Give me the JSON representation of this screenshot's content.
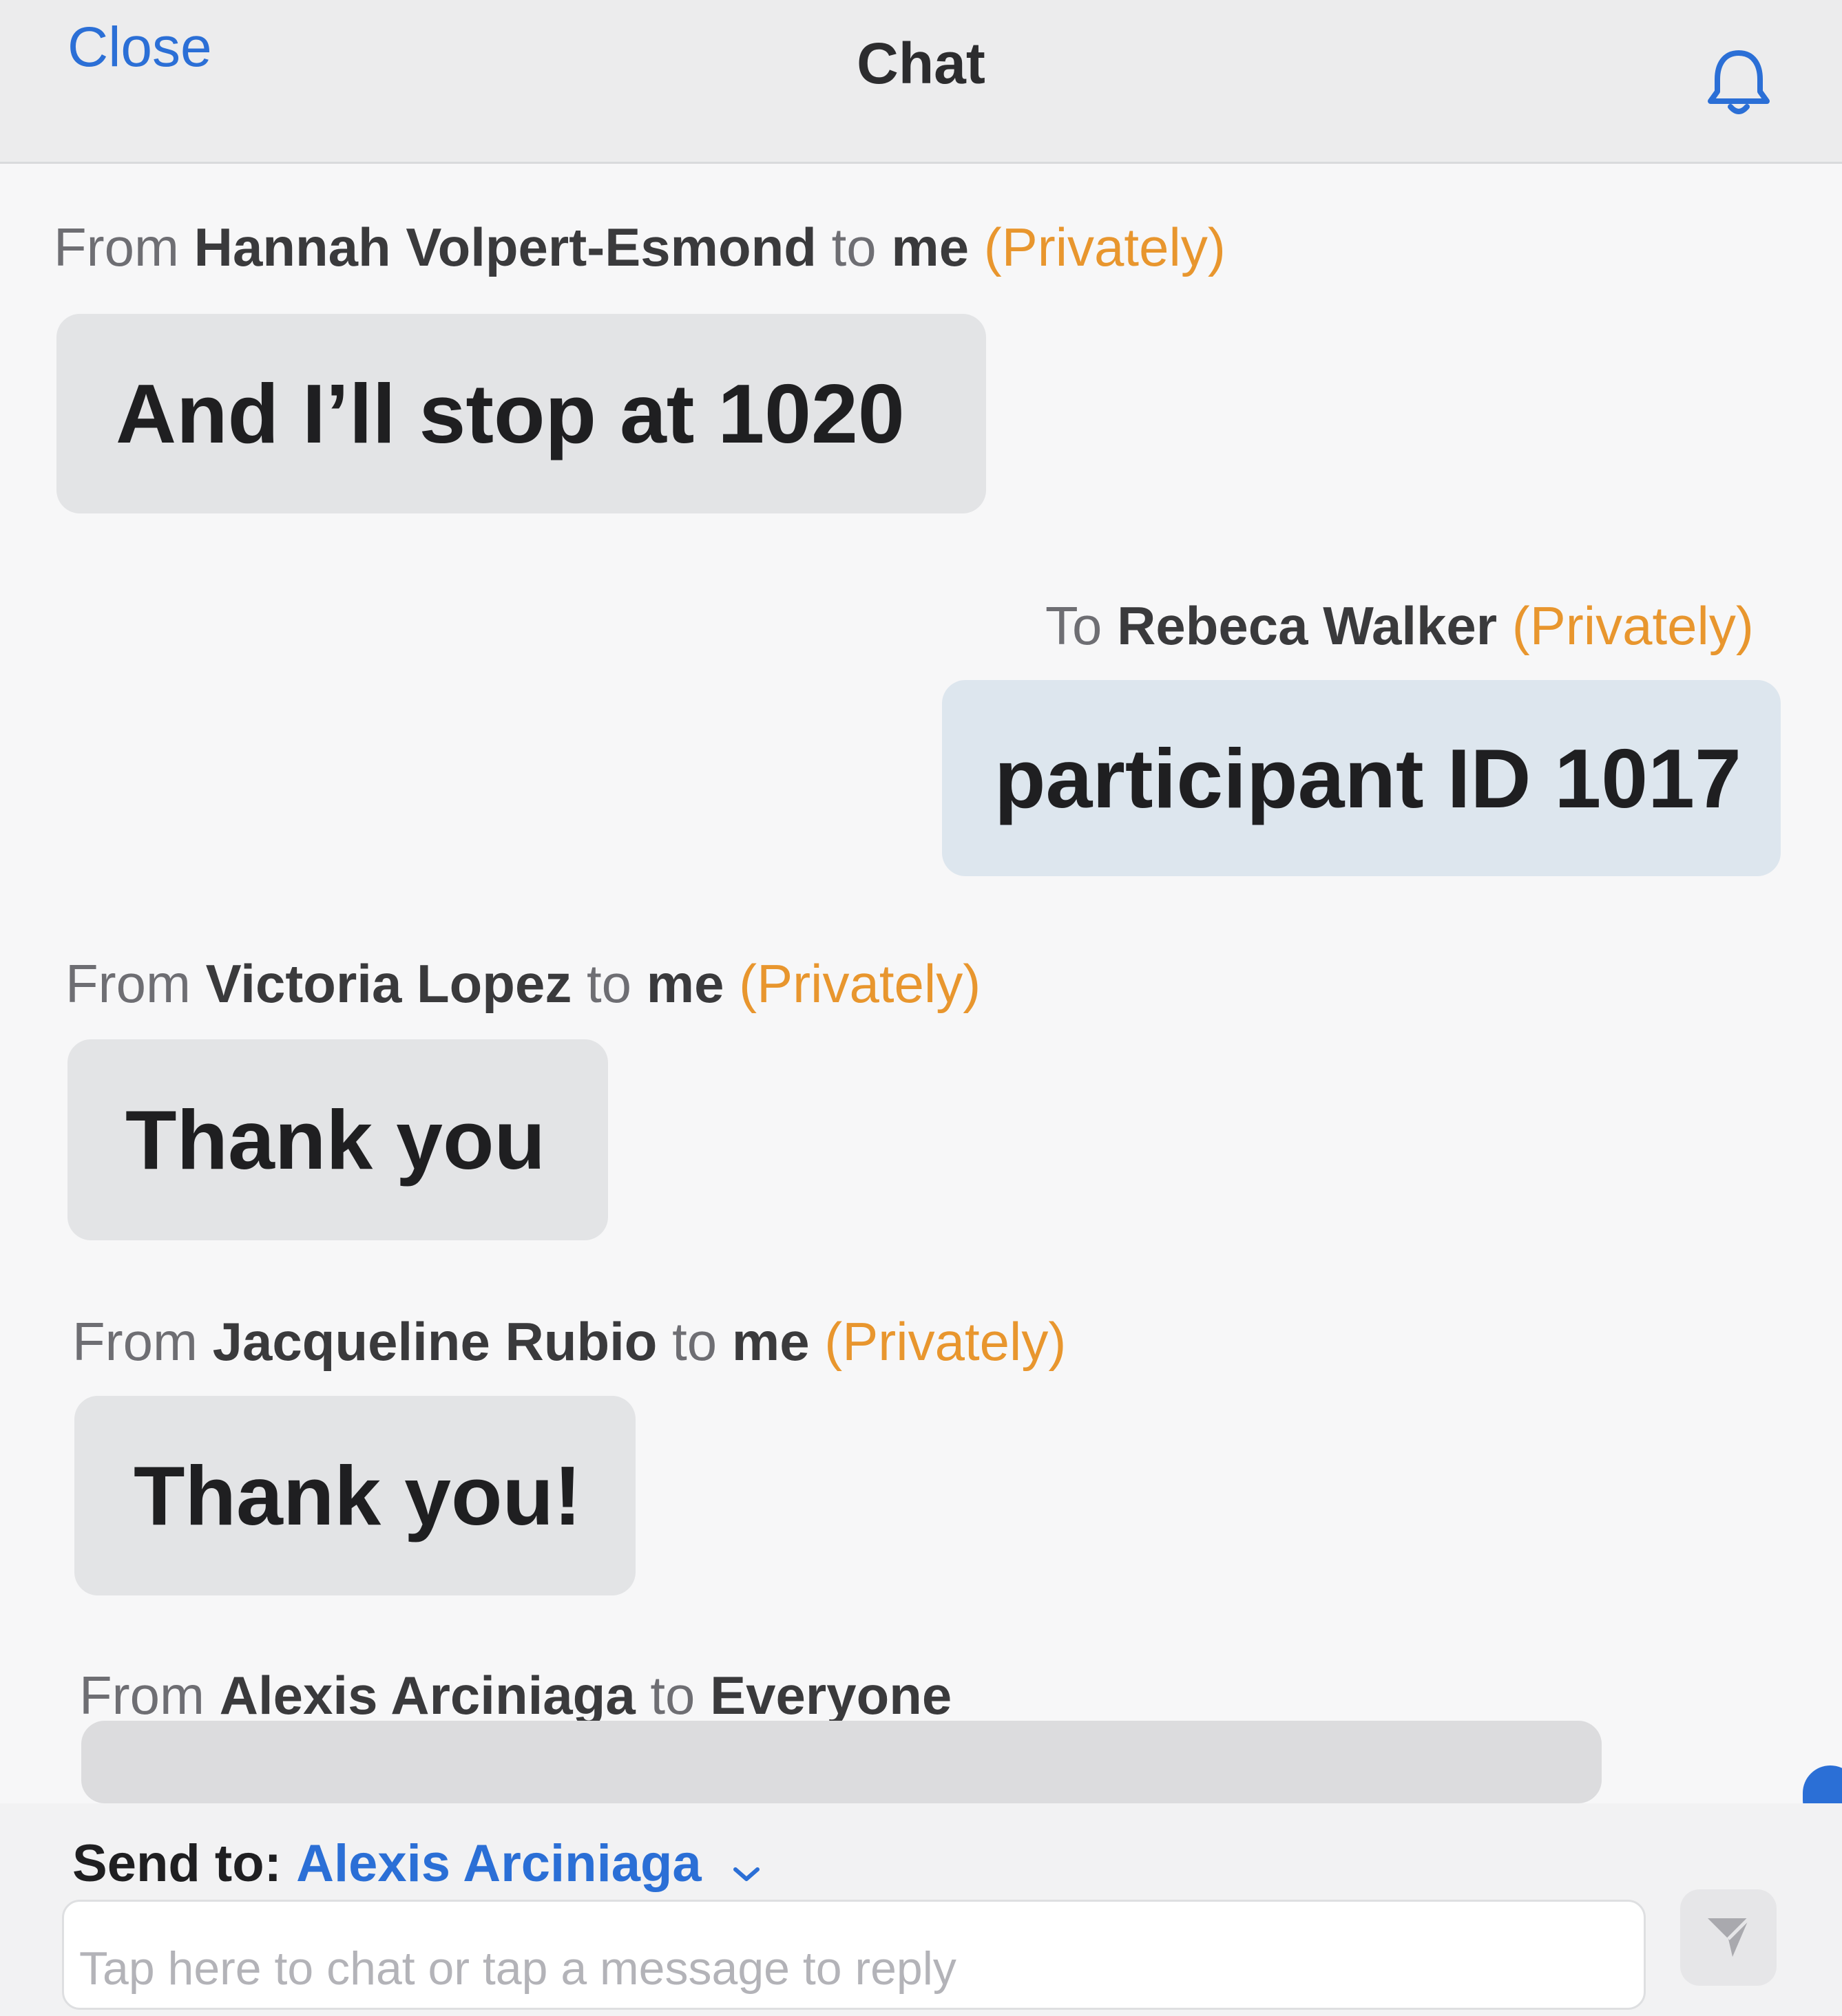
{
  "header": {
    "close_label": "Close",
    "title": "Chat",
    "bell_icon": "bell-icon"
  },
  "messages": [
    {
      "prefix": "From",
      "sender": "Hannah Volpert-Esmond",
      "connector": "to",
      "recipient": "me",
      "privacy": "(Privately)",
      "text": "And I’ll stop at 1020"
    },
    {
      "prefix": "To",
      "recipient": "Rebeca Walker",
      "privacy": "(Privately)",
      "text": "participant ID 1017"
    },
    {
      "prefix": "From",
      "sender": "Victoria Lopez",
      "connector": "to",
      "recipient": "me",
      "privacy": "(Privately)",
      "text": "Thank you"
    },
    {
      "prefix": "From",
      "sender": "Jacqueline Rubio",
      "connector": "to",
      "recipient": "me",
      "privacy": "(Privately)",
      "text": "Thank you!"
    },
    {
      "prefix": "From",
      "sender": "Alexis Arciniaga",
      "connector": "to",
      "recipient": "Everyone"
    }
  ],
  "send_to": {
    "label": "Send to:",
    "value": "Alexis Arciniaga"
  },
  "composer": {
    "placeholder": "Tap here to chat or tap a message to reply",
    "send_icon": "send-icon"
  },
  "colors": {
    "accent": "#2b6fd6",
    "private": "#e8962e"
  }
}
